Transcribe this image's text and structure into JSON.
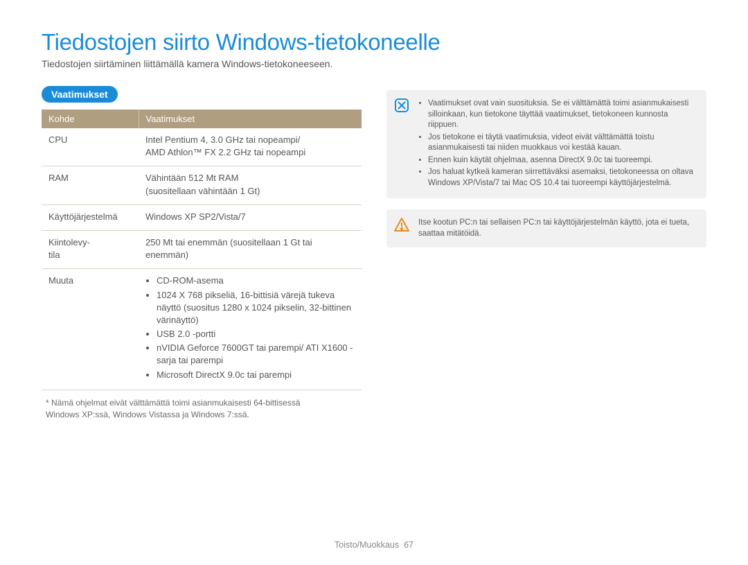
{
  "title": "Tiedostojen siirto Windows-tietokoneelle",
  "subtitle": "Tiedostojen siirtäminen liittämällä kamera Windows-tietokoneeseen.",
  "section_pill": "Vaatimukset",
  "table": {
    "headers": {
      "col1": "Kohde",
      "col2": "Vaatimukset"
    },
    "rows": {
      "cpu": {
        "key": "CPU",
        "val_line1": "Intel Pentium 4, 3.0 GHz tai nopeampi/",
        "val_line2": "AMD Athlon™ FX 2.2 GHz tai nopeampi"
      },
      "ram": {
        "key": "RAM",
        "val_line1": "Vähintään 512 Mt RAM",
        "val_line2": "(suositellaan vähintään 1 Gt)"
      },
      "os": {
        "key": "Käyttöjärjestelmä",
        "val": "Windows XP SP2/Vista/7"
      },
      "disk": {
        "key_line1": "Kiintolevy-",
        "key_line2": "tila",
        "val": "250 Mt tai enemmän (suositellaan 1 Gt tai enemmän)"
      },
      "other": {
        "key": "Muuta",
        "items": {
          "a": "CD-ROM-asema",
          "b": "1024 X 768 pikseliä, 16-bittisiä värejä tukeva näyttö (suositus 1280 x 1024 pikselin, 32-bittinen värinäyttö)",
          "c": "USB 2.0 -portti",
          "d": "nVIDIA Geforce 7600GT tai parempi/ ATI X1600 -sarja tai parempi",
          "e": "Microsoft DirectX 9.0c tai parempi"
        }
      }
    }
  },
  "footnote_line1": "* Nämä ohjelmat eivät välttämättä toimi asianmukaisesti 64-bittisessä",
  "footnote_line2": "Windows XP:ssä, Windows Vistassa ja Windows 7:ssä.",
  "note_items": {
    "a": "Vaatimukset ovat vain suosituksia. Se ei välttämättä toimi asianmukaisesti silloinkaan, kun tietokone täyttää vaatimukset, tietokoneen kunnosta riippuen.",
    "b": "Jos tietokone ei täytä vaatimuksia, videot eivät välttämättä toistu asianmukaisesti tai niiden muokkaus voi kestää kauan.",
    "c": "Ennen kuin käytät ohjelmaa, asenna DirectX 9.0c tai tuoreempi.",
    "d": "Jos haluat kytkeä kameran siirrettäväksi asemaksi, tietokoneessa on oltava Windows XP/Vista/7 tai Mac OS 10.4 tai tuoreempi käyttöjärjestelmä."
  },
  "warn_text": "Itse kootun PC:n tai sellaisen PC:n tai käyttöjärjestelmän käyttö, jota ei tueta, saattaa mitätöidä.",
  "footer_section": "Toisto/Muokkaus",
  "footer_page": "67"
}
